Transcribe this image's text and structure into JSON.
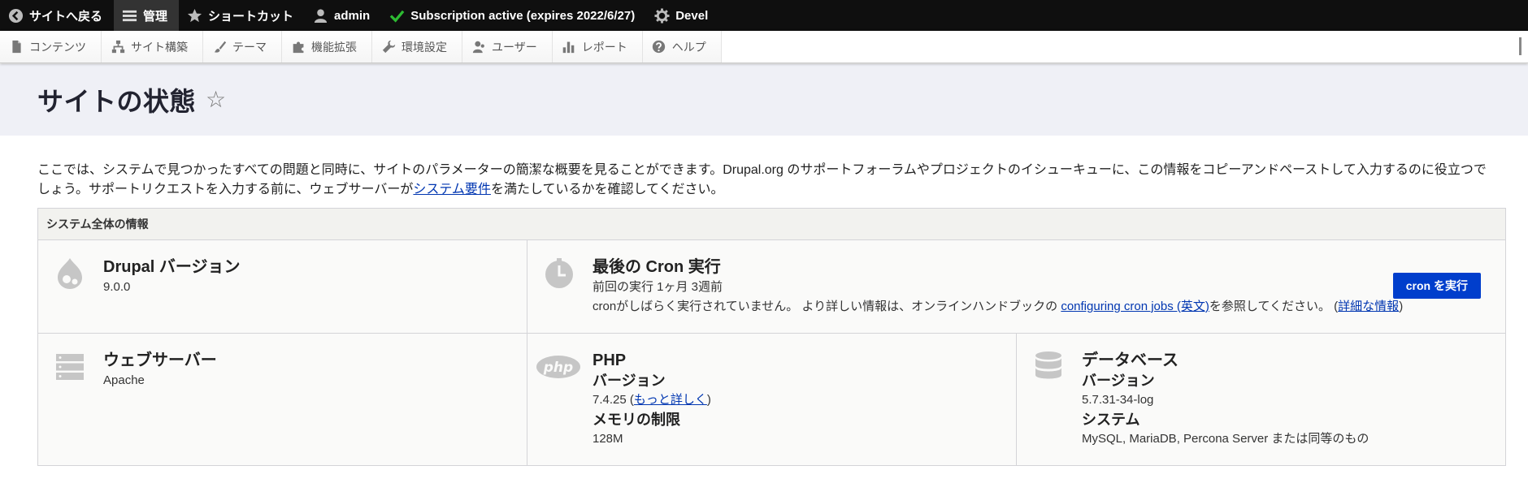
{
  "toolbar": {
    "back": "サイトへ戻る",
    "manage": "管理",
    "shortcuts": "ショートカット",
    "user": "admin",
    "subscription": "Subscription active (expires 2022/6/27)",
    "devel": "Devel"
  },
  "tray": {
    "items": [
      "コンテンツ",
      "サイト構築",
      "テーマ",
      "機能拡張",
      "環境設定",
      "ユーザー",
      "レポート",
      "ヘルプ"
    ]
  },
  "page": {
    "title": "サイトの状態",
    "favorite_icon": "star-outline"
  },
  "intro": {
    "text_before": "ここでは、システムで見つかったすべての問題と同時に、サイトのパラメーターの簡潔な概要を見ることができます。Drupal.org のサポートフォーラムやプロジェクトのイシューキューに、この情報をコピーアンドペーストして入力するのに役立つでしょう。サポートリクエストを入力する前に、ウェブサーバーが",
    "link": "システム要件",
    "text_after": "を満たしているかを確認してください。"
  },
  "general": {
    "title": "システム全体の情報",
    "drupal": {
      "heading": "Drupal バージョン",
      "value": "9.0.0"
    },
    "cron": {
      "heading": "最後の Cron 実行",
      "last_run": "前回の実行 1ヶ月 3週前",
      "note_before": "cronがしばらく実行されていません。 より詳しい情報は、オンラインハンドブックの ",
      "note_link": "configuring cron jobs (英文)",
      "note_after": "を参照してください。 (",
      "more_link": "詳細な情報",
      "note_close": ")",
      "button": "cron を実行"
    },
    "webserver": {
      "heading": "ウェブサーバー",
      "value": "Apache"
    },
    "php": {
      "heading": "PHP",
      "version_label": "バージョン",
      "version": "7.4.25 (",
      "version_link": "もっと詳しく",
      "version_close": ")",
      "memory_label": "メモリの制限",
      "memory": "128M",
      "logo_text": "php"
    },
    "database": {
      "heading": "データベース",
      "version_label": "バージョン",
      "version": "5.7.31-34-log",
      "system_label": "システム",
      "system": "MySQL, MariaDB, Percona Server または同等のもの"
    }
  },
  "colors": {
    "toolbar_bg": "#0f0f0f",
    "header_bg": "#eff0f6",
    "link": "#0036b1",
    "button": "#003ecc",
    "check": "#2dbb32"
  }
}
